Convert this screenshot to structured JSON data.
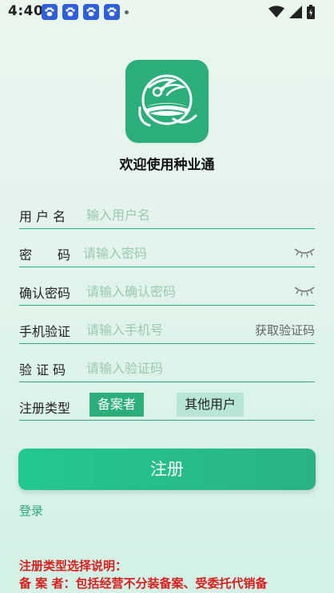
{
  "status_bar": {
    "time": "4:40",
    "notification_icons": [
      "baidu-paw-icon",
      "baidu-paw-icon",
      "baidu-paw-icon",
      "baidu-paw-icon"
    ],
    "right_icons": [
      "wifi-icon",
      "cell-signal-icon",
      "battery-icon"
    ]
  },
  "app": {
    "title": "欢迎使用种业通",
    "logo_icon": "app-logo-icon",
    "accent_color": "#2cae7b"
  },
  "form": {
    "username": {
      "label": "用 户 名",
      "placeholder": "输入用户名",
      "value": ""
    },
    "password": {
      "label": "密　　码",
      "placeholder": "请输入密码",
      "value": "",
      "toggle_icon": "eye-closed-icon"
    },
    "confirm_password": {
      "label": "确认密码",
      "placeholder": "请输入确认密码",
      "value": "",
      "toggle_icon": "eye-closed-icon"
    },
    "phone": {
      "label": "手机验证",
      "placeholder": "请输入手机号",
      "value": "",
      "get_code_label": "获取验证码"
    },
    "code": {
      "label": "验 证 码",
      "placeholder": "请输入验证码",
      "value": ""
    },
    "register_type": {
      "label": "注册类型",
      "options": [
        "备案者",
        "其他用户"
      ],
      "selected": "备案者"
    }
  },
  "actions": {
    "register_label": "注册",
    "login_label": "登录"
  },
  "notes": {
    "title": "注册类型选择说明：",
    "line1": "备 案 者：包括经营不分装备案、受委托代销备"
  }
}
